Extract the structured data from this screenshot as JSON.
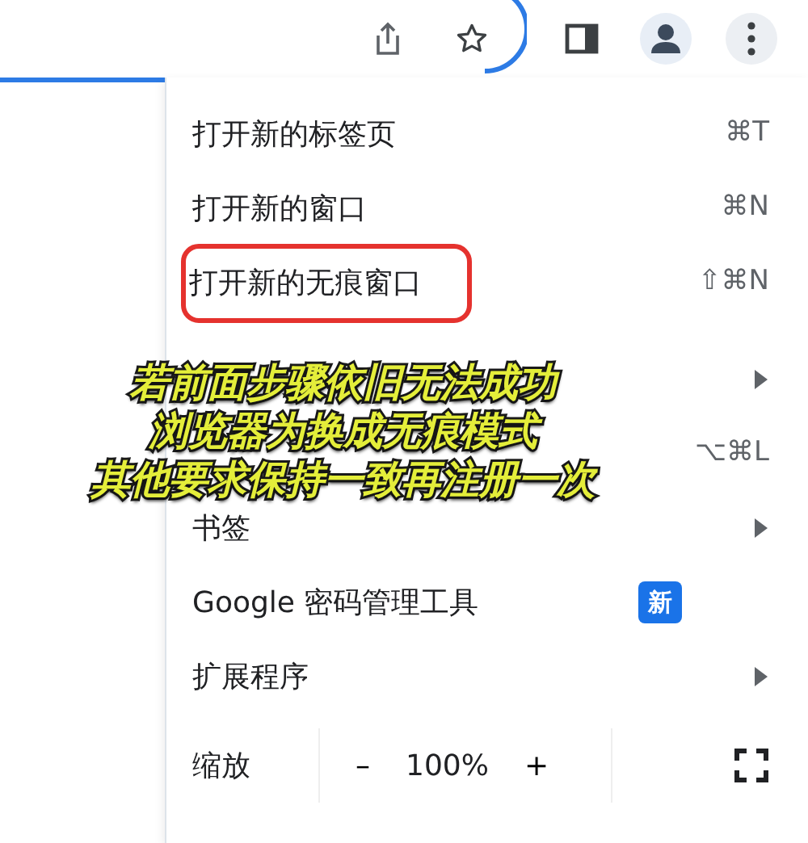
{
  "menu": {
    "items": [
      {
        "kind": "item",
        "label": "打开新的标签页",
        "shortcut": "⌘T",
        "submenu": false,
        "highlighted": false
      },
      {
        "kind": "item",
        "label": "打开新的窗口",
        "shortcut": "⌘N",
        "submenu": false,
        "highlighted": false
      },
      {
        "kind": "item",
        "label": "打开新的无痕窗口",
        "shortcut": "⇧⌘N",
        "submenu": false,
        "highlighted": true
      },
      {
        "kind": "divider"
      },
      {
        "kind": "item",
        "submenu": true,
        "highlighted": false
      },
      {
        "kind": "item",
        "shortcut": "⌥⌘L",
        "submenu": false,
        "highlighted": false
      },
      {
        "kind": "item",
        "label": "书签",
        "submenu": true,
        "highlighted": false
      },
      {
        "kind": "item",
        "label": "Google 密码管理工具",
        "badge": "新",
        "submenu": false,
        "highlighted": false
      },
      {
        "kind": "item",
        "label": "扩展程序",
        "submenu": true,
        "highlighted": false
      },
      {
        "kind": "zoom",
        "label": "缩放",
        "minus": "–",
        "value": "100%",
        "plus": "+"
      }
    ]
  },
  "caption": [
    "若前面步骤依旧无法成功",
    "浏览器为换成无痕模式",
    "其他要求保持一致再注册一次"
  ]
}
